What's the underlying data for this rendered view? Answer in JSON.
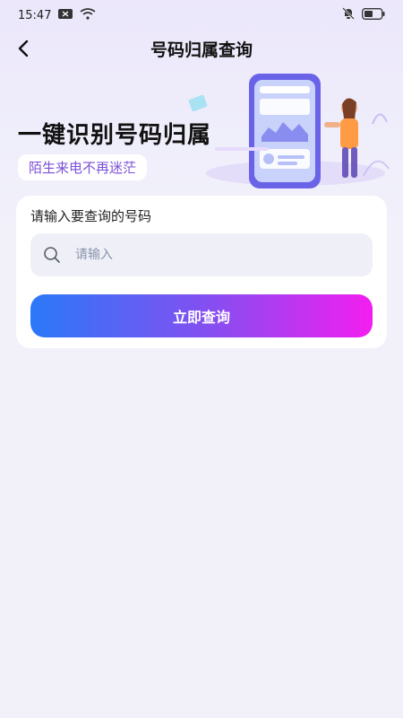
{
  "status_bar": {
    "time": "15:47"
  },
  "nav": {
    "title": "号码归属查询"
  },
  "hero": {
    "title": "一键识别号码归属",
    "subtitle": "陌生来电不再迷茫"
  },
  "form": {
    "label": "请输入要查询的号码",
    "placeholder": "请输入",
    "value": "",
    "button_label": "立即查询"
  },
  "icons": {
    "back": "chevron-left-icon",
    "search": "search-icon",
    "wifi": "wifi-icon",
    "battery": "battery-icon",
    "notification": "notification-icon",
    "bell_off": "bell-off-icon"
  },
  "colors": {
    "background": "#f2f1fa",
    "accent_start": "#2a79f8",
    "accent_end": "#f31ef0",
    "badge_text": "#7b4fd6"
  }
}
